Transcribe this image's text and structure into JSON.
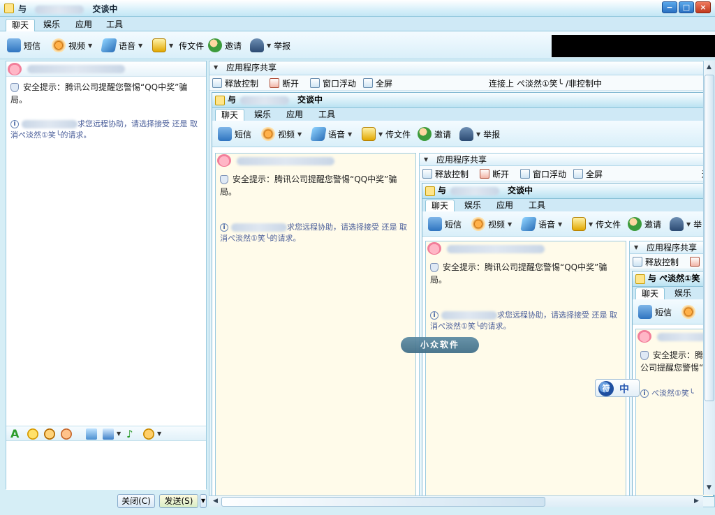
{
  "window": {
    "title_prefix": "与",
    "title_suffix": "交谈中",
    "controls": [
      "−",
      "□",
      "×"
    ]
  },
  "tabs": [
    "聊天",
    "娱乐",
    "应用",
    "工具"
  ],
  "toolbar": {
    "sms": "短信",
    "video": "视频",
    "voice": "语音",
    "file": "传文件",
    "invite": "邀请",
    "report": "举报"
  },
  "chat": {
    "security_tip": "安全提示：腾讯公司提醒您警惕“QQ中奖”骗局。",
    "request_tail": "求您远程协助，请选择接受 还是 取消",
    "request_name": "ぺ淡然①笑╰",
    "request_end": "的请求。",
    "buttons": {
      "close": "关闭(C)",
      "send": "发送(S)"
    }
  },
  "share": {
    "header": "应用程序共享",
    "release": "释放控制",
    "disconnect": "断开",
    "float": "窗口浮动",
    "fullscreen": "全屏",
    "status_prefix": "连接上",
    "status_name": "ぺ淡然①笑╰",
    "status_suffix": "/非控制中",
    "expand": "»"
  },
  "nested": {
    "title_prefix": "与",
    "title_suffix": "交谈中",
    "deep_title": "与 ぺ淡然①笑",
    "edge_label": "连",
    "report_short": "举"
  },
  "watermark": "小众软件",
  "ime": {
    "label": "中",
    "logo": "符"
  }
}
